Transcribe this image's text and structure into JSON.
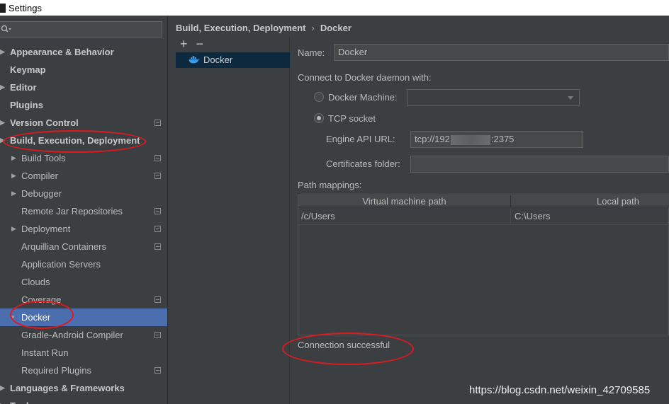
{
  "window": {
    "title": "Settings"
  },
  "sidebar": {
    "search": {
      "value": "",
      "placeholder": ""
    },
    "items": [
      {
        "label": "Appearance & Behavior",
        "level": 0,
        "bold": true,
        "arrow": true,
        "project_icon": false
      },
      {
        "label": "Keymap",
        "level": 0,
        "bold": true,
        "arrow": false,
        "project_icon": false
      },
      {
        "label": "Editor",
        "level": 0,
        "bold": true,
        "arrow": true,
        "project_icon": false
      },
      {
        "label": "Plugins",
        "level": 0,
        "bold": true,
        "arrow": false,
        "project_icon": false
      },
      {
        "label": "Version Control",
        "level": 0,
        "bold": true,
        "arrow": true,
        "project_icon": true
      },
      {
        "label": "Build, Execution, Deployment",
        "level": 0,
        "bold": true,
        "arrow": true,
        "project_icon": false
      },
      {
        "label": "Build Tools",
        "level": 1,
        "bold": false,
        "arrow": true,
        "project_icon": true
      },
      {
        "label": "Compiler",
        "level": 1,
        "bold": false,
        "arrow": true,
        "project_icon": true
      },
      {
        "label": "Debugger",
        "level": 1,
        "bold": false,
        "arrow": true,
        "project_icon": false
      },
      {
        "label": "Remote Jar Repositories",
        "level": 1,
        "bold": false,
        "arrow": false,
        "project_icon": true
      },
      {
        "label": "Deployment",
        "level": 1,
        "bold": false,
        "arrow": true,
        "project_icon": true
      },
      {
        "label": "Arquillian Containers",
        "level": 1,
        "bold": false,
        "arrow": false,
        "project_icon": true
      },
      {
        "label": "Application Servers",
        "level": 1,
        "bold": false,
        "arrow": false,
        "project_icon": false
      },
      {
        "label": "Clouds",
        "level": 1,
        "bold": false,
        "arrow": false,
        "project_icon": false
      },
      {
        "label": "Coverage",
        "level": 1,
        "bold": false,
        "arrow": false,
        "project_icon": true
      },
      {
        "label": "Docker",
        "level": 1,
        "bold": false,
        "arrow": true,
        "project_icon": false,
        "selected": true
      },
      {
        "label": "Gradle-Android Compiler",
        "level": 1,
        "bold": false,
        "arrow": false,
        "project_icon": true
      },
      {
        "label": "Instant Run",
        "level": 1,
        "bold": false,
        "arrow": false,
        "project_icon": false
      },
      {
        "label": "Required Plugins",
        "level": 1,
        "bold": false,
        "arrow": false,
        "project_icon": true
      },
      {
        "label": "Languages & Frameworks",
        "level": 0,
        "bold": true,
        "arrow": true,
        "project_icon": false
      },
      {
        "label": "Tools",
        "level": 0,
        "bold": true,
        "arrow": true,
        "project_icon": false
      }
    ]
  },
  "breadcrumb": {
    "parent": "Build, Execution, Deployment",
    "separator": "›",
    "current": "Docker"
  },
  "config_list": {
    "add_label": "+",
    "remove_label": "−",
    "items": [
      {
        "label": "Docker"
      }
    ]
  },
  "form": {
    "name_label": "Name:",
    "name_value": "Docker",
    "connect_label": "Connect to Docker daemon with:",
    "docker_machine_label": "Docker Machine:",
    "docker_machine_value": "",
    "tcp_socket_label": "TCP socket",
    "engine_api_label": "Engine API URL:",
    "engine_api_prefix": "tcp://192",
    "engine_api_suffix": ":2375",
    "certificates_label": "Certificates folder:",
    "certificates_value": "",
    "path_mappings_label": "Path mappings:",
    "table": {
      "columns": [
        "Virtual machine path",
        "Local path"
      ],
      "rows": [
        [
          "/c/Users",
          "C:\\Users"
        ]
      ]
    },
    "status": "Connection successful"
  },
  "watermark": "https://blog.csdn.net/weixin_42709585",
  "colors": {
    "background": "#3c3f41",
    "selection": "#4b6eaf",
    "annotation": "#e0191e"
  }
}
